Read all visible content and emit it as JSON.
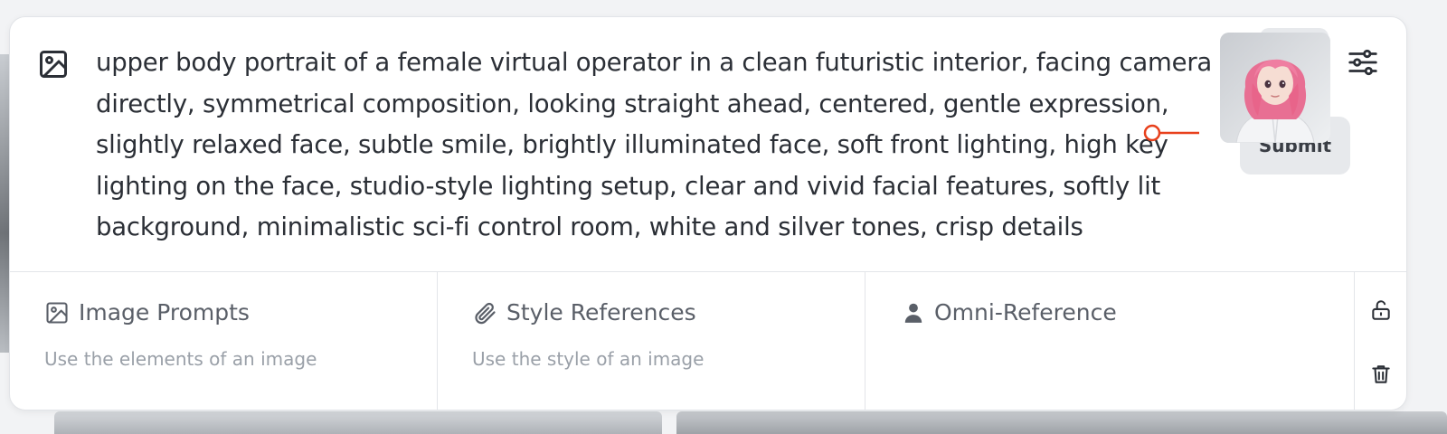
{
  "prompt": {
    "text": "upper body portrait of a female virtual operator in a clean futuristic interior, facing camera directly, symmetrical composition, looking straight ahead, centered, gentle expression, slightly relaxed face, subtle smile, brightly illuminated face, soft front lighting, high key lighting on the face, studio-style lighting setup, clear and vivid facial features, softly lit background, minimalistic sci-fi control room, white and silver tones, crisp details",
    "leading_icon": "image-icon"
  },
  "actions": {
    "send_icon": "send-icon",
    "settings_icon": "sliders-icon",
    "submit_label": "Submit"
  },
  "references": [
    {
      "title": "Image Prompts",
      "subtitle": "Use the elements of an image",
      "icon": "image-icon"
    },
    {
      "title": "Style References",
      "subtitle": "Use the style of an image",
      "icon": "paperclip-icon"
    },
    {
      "title": "Omni-Reference",
      "subtitle": "",
      "icon": "person-icon"
    }
  ],
  "omni": {
    "thumbnail": "pink-haired-avatar",
    "strength_slider": 0,
    "lock_icon": "unlock-icon",
    "delete_icon": "trash-icon"
  },
  "colors": {
    "text": "#2b2f36",
    "muted": "#9aa0a8",
    "button_bg": "#e7e9ec",
    "slider_accent": "#e8401c"
  }
}
